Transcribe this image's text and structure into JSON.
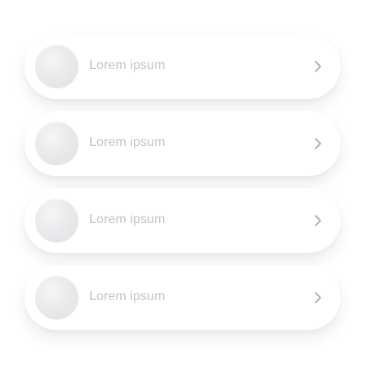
{
  "list": {
    "items": [
      {
        "label": "Lorem ipsum",
        "icon": "chevron-right-icon"
      },
      {
        "label": "Lorem ipsum",
        "icon": "chevron-right-icon"
      },
      {
        "label": "Lorem ipsum",
        "icon": "chevron-right-icon"
      },
      {
        "label": "Lorem ipsum",
        "icon": "chevron-right-icon"
      }
    ]
  },
  "colors": {
    "background": "#ffffff",
    "card": "#ffffff",
    "avatar": "#e6e6e9",
    "label_text": "#c4c4c8",
    "chevron": "#a9a9ad"
  }
}
